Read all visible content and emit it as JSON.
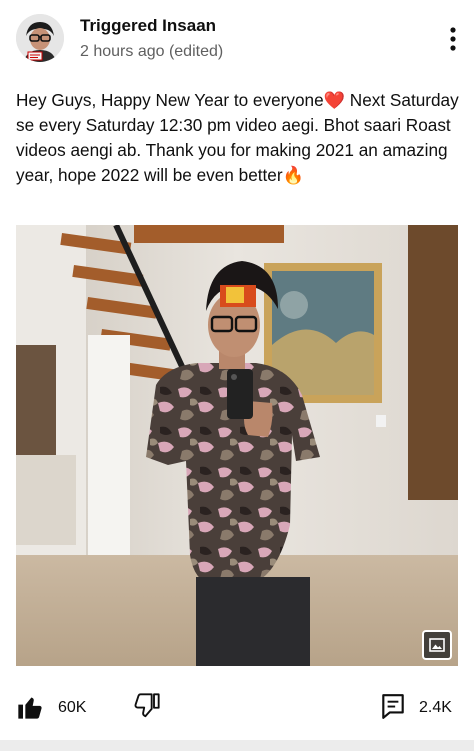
{
  "post": {
    "channel_name": "Triggered Insaan",
    "timestamp": "2 hours ago (edited)",
    "text": "Hey Guys, Happy New Year to everyone❤️ Next Saturday se every Saturday 12:30 pm video aegi. Bhot saari Roast videos aengi ab. Thank you for making 2021 an amazing year, hope 2022 will be even better🔥"
  },
  "actions": {
    "like_count": "60K",
    "comment_count": "2.4K"
  },
  "icons": {
    "like": "thumbs-up-filled-icon",
    "dislike": "thumbs-down-outline-icon",
    "comment": "comment-icon",
    "more": "more-vertical-icon",
    "image": "image-icon"
  },
  "colors": {
    "text": "#0f0f0f",
    "secondary_text": "#606060",
    "background": "#ffffff"
  }
}
